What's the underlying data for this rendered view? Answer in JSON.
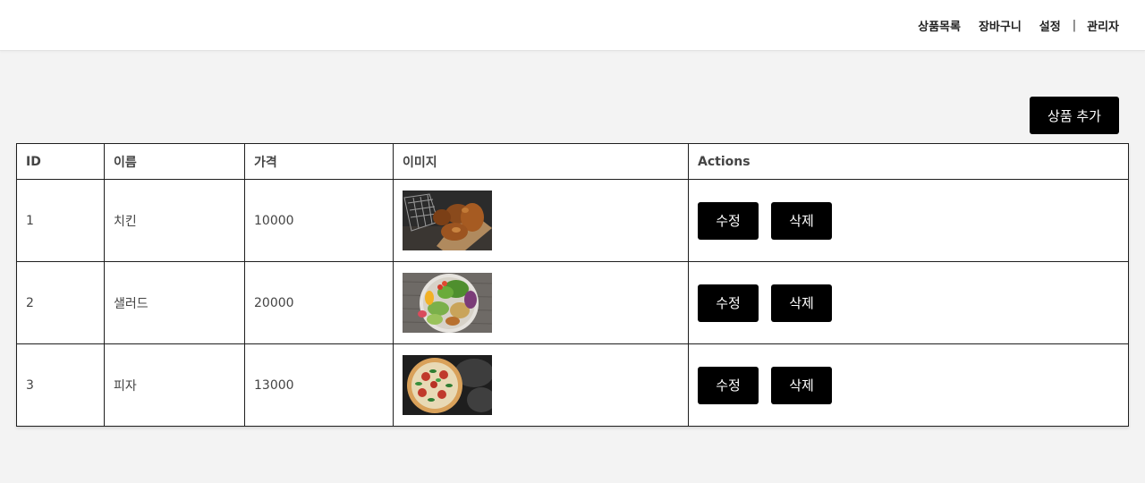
{
  "nav": {
    "items": [
      "상품목록",
      "장바구니",
      "설정"
    ],
    "separator": "|",
    "admin": "관리자"
  },
  "toolbar": {
    "add_label": "상품 추가"
  },
  "table": {
    "headers": [
      "ID",
      "이름",
      "가격",
      "이미지",
      "Actions"
    ],
    "rows": [
      {
        "id": "1",
        "name": "치킨",
        "price": "10000",
        "image": "fried-chicken-photo"
      },
      {
        "id": "2",
        "name": "샐러드",
        "price": "20000",
        "image": "salad-bowl-photo"
      },
      {
        "id": "3",
        "name": "피자",
        "price": "13000",
        "image": "pizza-photo"
      }
    ],
    "edit_label": "수정",
    "delete_label": "삭제"
  },
  "colors": {
    "button_bg": "#000000",
    "page_bg": "#f3f3f3",
    "border": "#1e1e1e"
  }
}
